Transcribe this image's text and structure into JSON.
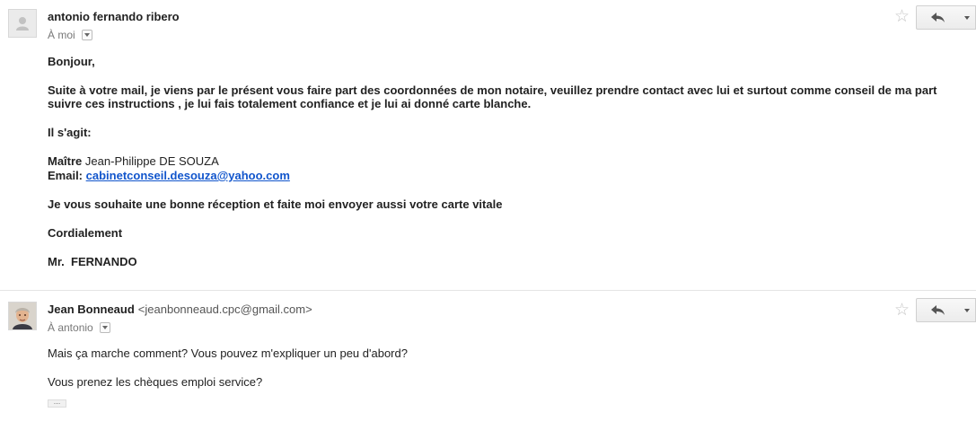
{
  "messages": [
    {
      "sender": {
        "name": "antonio fernando ribero",
        "email": ""
      },
      "recipient": "À moi",
      "body": {
        "greeting": "Bonjour,",
        "para1_line1": "Suite à votre mail, je viens par le présent vous faire part des coordonnées de mon notaire, veuillez prendre contact avec lui et surtout comme conseil de ma part",
        "para1_line2": "suivre ces instructions , je lui fais totalement confiance et je lui ai donné carte blanche.",
        "intro": "Il s'agit:",
        "notary_prefix": "Maître",
        "notary_name": "Jean-Philippe DE SOUZA",
        "email_label": "Email:",
        "email_link": "cabinetconseil.desouza@yahoo.com",
        "closing1": "Je vous souhaite une bonne réception et faite moi envoyer aussi votre carte vitale",
        "closing2": "Cordialement",
        "signature": "Mr.  FERNANDO"
      }
    },
    {
      "sender": {
        "name": "Jean Bonneaud",
        "email": "<jeanbonneaud.cpc@gmail.com>"
      },
      "recipient": "À antonio",
      "body": {
        "line1": "Mais ça marche comment? Vous pouvez m'expliquer un peu d'abord?",
        "line2": "Vous prenez les chèques emploi service?"
      },
      "ellipsis": "..."
    }
  ],
  "icons": {
    "star": "star-icon",
    "reply": "reply-arrow-icon",
    "more": "dropdown-arrow-icon"
  },
  "colors": {
    "link": "#1155cc",
    "star": "#c6c6c6",
    "text": "#222222",
    "meta": "#777777"
  }
}
